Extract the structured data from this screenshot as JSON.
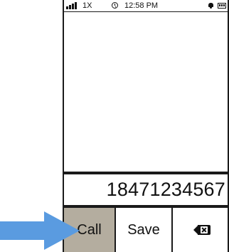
{
  "statusbar": {
    "signal_icon": "signal-strength-icon",
    "network": "1X",
    "alarm_icon": "clock-icon",
    "time": "12:58 PM",
    "vibrate_icon": "vibrate-icon",
    "battery_icon": "battery-icon"
  },
  "dialer": {
    "number": "18471234567"
  },
  "softkeys": {
    "call_label": "Call",
    "save_label": "Save",
    "delete_icon": "backspace-icon"
  },
  "callout": {
    "arrow_icon": "arrow-right-icon",
    "arrow_color": "#5a9be0"
  },
  "colors": {
    "call_key_bg": "#b4ad9f",
    "frame": "#1a1a1a"
  }
}
